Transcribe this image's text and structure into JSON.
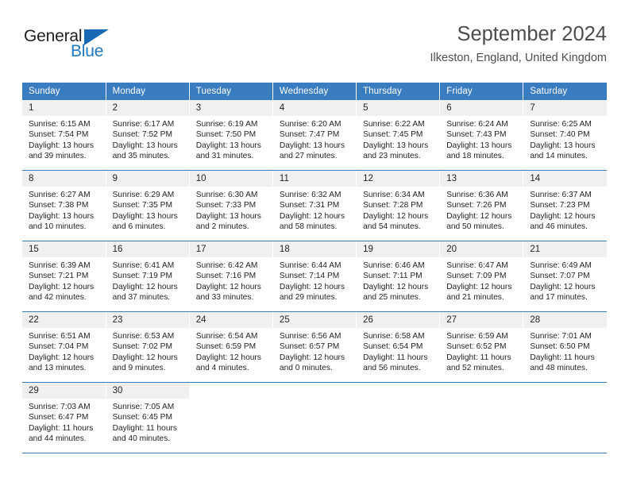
{
  "brand": {
    "name_top": "General",
    "name_bottom": "Blue",
    "accent_color": "#1668b3",
    "triangle_icon": "triangle-icon"
  },
  "header": {
    "month_title": "September 2024",
    "location": "Ilkeston, England, United Kingdom"
  },
  "theme": {
    "header_blue": "#3a7cc0",
    "daynum_band": "#f0f0f0",
    "text": "#231f20",
    "title_gray": "#4d4d4d"
  },
  "calendar": {
    "weekday_headers": [
      "Sunday",
      "Monday",
      "Tuesday",
      "Wednesday",
      "Thursday",
      "Friday",
      "Saturday"
    ],
    "weeks": [
      [
        {
          "day": "1",
          "sunrise": "Sunrise: 6:15 AM",
          "sunset": "Sunset: 7:54 PM",
          "daylight_1": "Daylight: 13 hours",
          "daylight_2": "and 39 minutes."
        },
        {
          "day": "2",
          "sunrise": "Sunrise: 6:17 AM",
          "sunset": "Sunset: 7:52 PM",
          "daylight_1": "Daylight: 13 hours",
          "daylight_2": "and 35 minutes."
        },
        {
          "day": "3",
          "sunrise": "Sunrise: 6:19 AM",
          "sunset": "Sunset: 7:50 PM",
          "daylight_1": "Daylight: 13 hours",
          "daylight_2": "and 31 minutes."
        },
        {
          "day": "4",
          "sunrise": "Sunrise: 6:20 AM",
          "sunset": "Sunset: 7:47 PM",
          "daylight_1": "Daylight: 13 hours",
          "daylight_2": "and 27 minutes."
        },
        {
          "day": "5",
          "sunrise": "Sunrise: 6:22 AM",
          "sunset": "Sunset: 7:45 PM",
          "daylight_1": "Daylight: 13 hours",
          "daylight_2": "and 23 minutes."
        },
        {
          "day": "6",
          "sunrise": "Sunrise: 6:24 AM",
          "sunset": "Sunset: 7:43 PM",
          "daylight_1": "Daylight: 13 hours",
          "daylight_2": "and 18 minutes."
        },
        {
          "day": "7",
          "sunrise": "Sunrise: 6:25 AM",
          "sunset": "Sunset: 7:40 PM",
          "daylight_1": "Daylight: 13 hours",
          "daylight_2": "and 14 minutes."
        }
      ],
      [
        {
          "day": "8",
          "sunrise": "Sunrise: 6:27 AM",
          "sunset": "Sunset: 7:38 PM",
          "daylight_1": "Daylight: 13 hours",
          "daylight_2": "and 10 minutes."
        },
        {
          "day": "9",
          "sunrise": "Sunrise: 6:29 AM",
          "sunset": "Sunset: 7:35 PM",
          "daylight_1": "Daylight: 13 hours",
          "daylight_2": "and 6 minutes."
        },
        {
          "day": "10",
          "sunrise": "Sunrise: 6:30 AM",
          "sunset": "Sunset: 7:33 PM",
          "daylight_1": "Daylight: 13 hours",
          "daylight_2": "and 2 minutes."
        },
        {
          "day": "11",
          "sunrise": "Sunrise: 6:32 AM",
          "sunset": "Sunset: 7:31 PM",
          "daylight_1": "Daylight: 12 hours",
          "daylight_2": "and 58 minutes."
        },
        {
          "day": "12",
          "sunrise": "Sunrise: 6:34 AM",
          "sunset": "Sunset: 7:28 PM",
          "daylight_1": "Daylight: 12 hours",
          "daylight_2": "and 54 minutes."
        },
        {
          "day": "13",
          "sunrise": "Sunrise: 6:36 AM",
          "sunset": "Sunset: 7:26 PM",
          "daylight_1": "Daylight: 12 hours",
          "daylight_2": "and 50 minutes."
        },
        {
          "day": "14",
          "sunrise": "Sunrise: 6:37 AM",
          "sunset": "Sunset: 7:23 PM",
          "daylight_1": "Daylight: 12 hours",
          "daylight_2": "and 46 minutes."
        }
      ],
      [
        {
          "day": "15",
          "sunrise": "Sunrise: 6:39 AM",
          "sunset": "Sunset: 7:21 PM",
          "daylight_1": "Daylight: 12 hours",
          "daylight_2": "and 42 minutes."
        },
        {
          "day": "16",
          "sunrise": "Sunrise: 6:41 AM",
          "sunset": "Sunset: 7:19 PM",
          "daylight_1": "Daylight: 12 hours",
          "daylight_2": "and 37 minutes."
        },
        {
          "day": "17",
          "sunrise": "Sunrise: 6:42 AM",
          "sunset": "Sunset: 7:16 PM",
          "daylight_1": "Daylight: 12 hours",
          "daylight_2": "and 33 minutes."
        },
        {
          "day": "18",
          "sunrise": "Sunrise: 6:44 AM",
          "sunset": "Sunset: 7:14 PM",
          "daylight_1": "Daylight: 12 hours",
          "daylight_2": "and 29 minutes."
        },
        {
          "day": "19",
          "sunrise": "Sunrise: 6:46 AM",
          "sunset": "Sunset: 7:11 PM",
          "daylight_1": "Daylight: 12 hours",
          "daylight_2": "and 25 minutes."
        },
        {
          "day": "20",
          "sunrise": "Sunrise: 6:47 AM",
          "sunset": "Sunset: 7:09 PM",
          "daylight_1": "Daylight: 12 hours",
          "daylight_2": "and 21 minutes."
        },
        {
          "day": "21",
          "sunrise": "Sunrise: 6:49 AM",
          "sunset": "Sunset: 7:07 PM",
          "daylight_1": "Daylight: 12 hours",
          "daylight_2": "and 17 minutes."
        }
      ],
      [
        {
          "day": "22",
          "sunrise": "Sunrise: 6:51 AM",
          "sunset": "Sunset: 7:04 PM",
          "daylight_1": "Daylight: 12 hours",
          "daylight_2": "and 13 minutes."
        },
        {
          "day": "23",
          "sunrise": "Sunrise: 6:53 AM",
          "sunset": "Sunset: 7:02 PM",
          "daylight_1": "Daylight: 12 hours",
          "daylight_2": "and 9 minutes."
        },
        {
          "day": "24",
          "sunrise": "Sunrise: 6:54 AM",
          "sunset": "Sunset: 6:59 PM",
          "daylight_1": "Daylight: 12 hours",
          "daylight_2": "and 4 minutes."
        },
        {
          "day": "25",
          "sunrise": "Sunrise: 6:56 AM",
          "sunset": "Sunset: 6:57 PM",
          "daylight_1": "Daylight: 12 hours",
          "daylight_2": "and 0 minutes."
        },
        {
          "day": "26",
          "sunrise": "Sunrise: 6:58 AM",
          "sunset": "Sunset: 6:54 PM",
          "daylight_1": "Daylight: 11 hours",
          "daylight_2": "and 56 minutes."
        },
        {
          "day": "27",
          "sunrise": "Sunrise: 6:59 AM",
          "sunset": "Sunset: 6:52 PM",
          "daylight_1": "Daylight: 11 hours",
          "daylight_2": "and 52 minutes."
        },
        {
          "day": "28",
          "sunrise": "Sunrise: 7:01 AM",
          "sunset": "Sunset: 6:50 PM",
          "daylight_1": "Daylight: 11 hours",
          "daylight_2": "and 48 minutes."
        }
      ],
      [
        {
          "day": "29",
          "sunrise": "Sunrise: 7:03 AM",
          "sunset": "Sunset: 6:47 PM",
          "daylight_1": "Daylight: 11 hours",
          "daylight_2": "and 44 minutes."
        },
        {
          "day": "30",
          "sunrise": "Sunrise: 7:05 AM",
          "sunset": "Sunset: 6:45 PM",
          "daylight_1": "Daylight: 11 hours",
          "daylight_2": "and 40 minutes."
        },
        {
          "day": "",
          "sunrise": "",
          "sunset": "",
          "daylight_1": "",
          "daylight_2": ""
        },
        {
          "day": "",
          "sunrise": "",
          "sunset": "",
          "daylight_1": "",
          "daylight_2": ""
        },
        {
          "day": "",
          "sunrise": "",
          "sunset": "",
          "daylight_1": "",
          "daylight_2": ""
        },
        {
          "day": "",
          "sunrise": "",
          "sunset": "",
          "daylight_1": "",
          "daylight_2": ""
        },
        {
          "day": "",
          "sunrise": "",
          "sunset": "",
          "daylight_1": "",
          "daylight_2": ""
        }
      ]
    ]
  }
}
